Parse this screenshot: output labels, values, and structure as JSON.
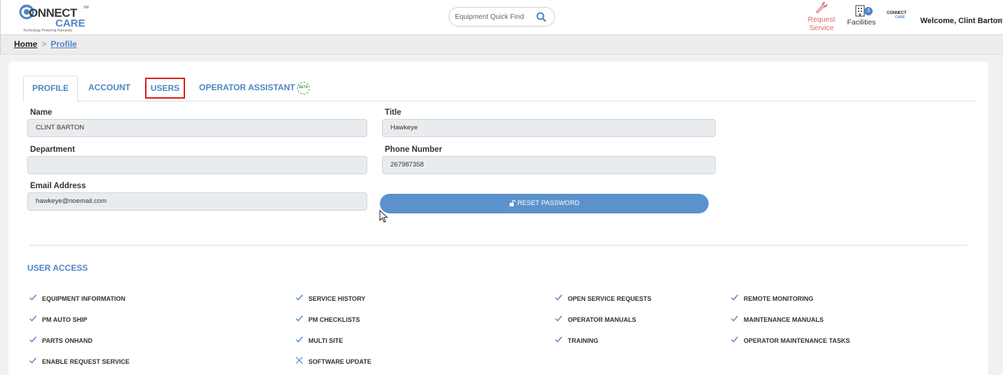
{
  "header": {
    "logo": {
      "connect": "ONNECT",
      "care": "CARE",
      "sm": "SM",
      "tagline": "Technology Powering Humanity"
    },
    "search": {
      "placeholder": "Equipment Quick Find"
    },
    "request_service": "Request Service",
    "facilities": {
      "label": "Facilities",
      "badge": "3"
    },
    "mini_logo": {
      "a": "CONNECT",
      "b": "CARE"
    },
    "welcome": "Welcome, Clint Barton"
  },
  "breadcrumb": {
    "home": "Home",
    "separator": ">",
    "current": "Profile"
  },
  "tabs": [
    {
      "label": "PROFILE"
    },
    {
      "label": "ACCOUNT"
    },
    {
      "label": "USERS"
    },
    {
      "label": "OPERATOR ASSISTANT",
      "badge": "BETA"
    }
  ],
  "form": {
    "name": {
      "label": "Name",
      "value": "CLINT BARTON"
    },
    "title": {
      "label": "Title",
      "value": "Hawkeye"
    },
    "department": {
      "label": "Department",
      "value": ""
    },
    "phone": {
      "label": "Phone Number",
      "value": "267987358"
    },
    "email": {
      "label": "Email Address",
      "value": "hawkeye@noemail.com"
    },
    "reset_password": "RESET PASSWORD"
  },
  "user_access": {
    "title": "USER ACCESS",
    "items": [
      {
        "label": "EQUIPMENT INFORMATION",
        "enabled": true
      },
      {
        "label": "SERVICE HISTORY",
        "enabled": true
      },
      {
        "label": "OPEN SERVICE REQUESTS",
        "enabled": true
      },
      {
        "label": "REMOTE MONITORING",
        "enabled": true
      },
      {
        "label": "PM AUTO SHIP",
        "enabled": true
      },
      {
        "label": "PM CHECKLISTS",
        "enabled": true
      },
      {
        "label": "OPERATOR MANUALS",
        "enabled": true
      },
      {
        "label": "MAINTENANCE MANUALS",
        "enabled": true
      },
      {
        "label": "PARTS ONHAND",
        "enabled": true
      },
      {
        "label": "MULTI SITE",
        "enabled": true
      },
      {
        "label": "TRAINING",
        "enabled": true
      },
      {
        "label": "OPERATOR MAINTENANCE TASKS",
        "enabled": true
      },
      {
        "label": "ENABLE REQUEST SERVICE",
        "enabled": true
      },
      {
        "label": "SOFTWARE UPDATE",
        "enabled": false
      }
    ]
  },
  "colors": {
    "accent": "#4e86c6",
    "request": "#e06666",
    "highlight": "#d12020",
    "button": "#5b92cc",
    "beta": "#39a855"
  }
}
